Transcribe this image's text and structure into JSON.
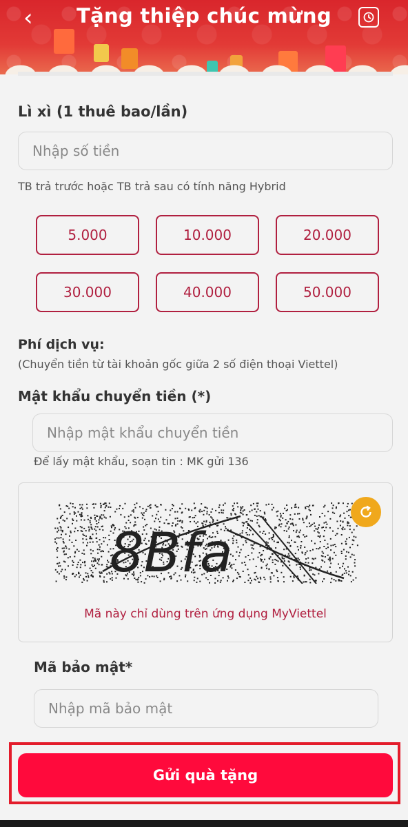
{
  "header": {
    "title": "Tặng thiệp chúc mừng",
    "back_icon": "chevron-left-icon",
    "history_icon": "clock-icon"
  },
  "lixi": {
    "title": "Lì xì (1 thuê bao/lần)",
    "amount_placeholder": "Nhập số tiền",
    "note": "TB trả trước hoặc TB trả sau có tính năng Hybrid",
    "amounts": [
      "5.000",
      "10.000",
      "20.000",
      "30.000",
      "40.000",
      "50.000"
    ]
  },
  "fee": {
    "title": "Phí dịch vụ:",
    "description": "(Chuyển tiền từ tài khoản gốc giữa 2 số điện thoại Viettel)"
  },
  "password": {
    "title": "Mật khẩu chuyển tiền (*)",
    "placeholder": "Nhập mật khẩu chuyển tiền",
    "hint": "Để lấy mật khẩu, soạn tin : MK gửi 136"
  },
  "captcha": {
    "text": "8Bfa",
    "note": "Mã này chỉ dùng trên ứng dụng MyViettel",
    "refresh_icon": "refresh-icon"
  },
  "security": {
    "title": "Mã bảo mật*",
    "placeholder": "Nhập mã bảo mật"
  },
  "submit": {
    "label": "Gửi quà tặng"
  },
  "colors": {
    "header_red": "#d9262c",
    "accent": "#b01f3f",
    "submit": "#ff0a3c",
    "highlight_frame": "#e31c2b",
    "refresh": "#f0a81c"
  }
}
